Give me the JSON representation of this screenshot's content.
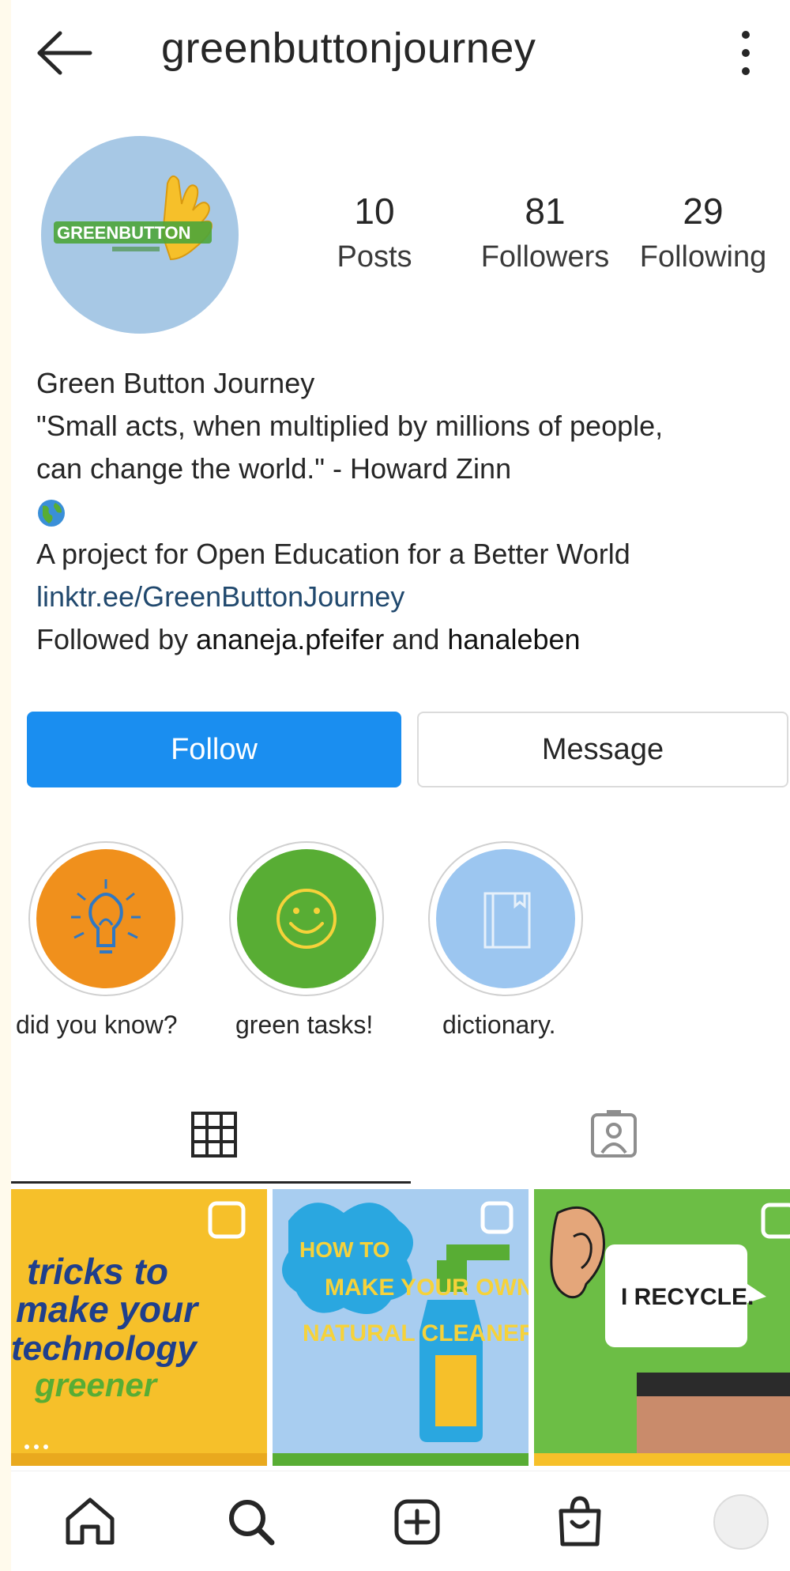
{
  "header": {
    "username": "greenbuttonjourney"
  },
  "profile": {
    "avatar_logo_text": "GREENBUTTON",
    "stats": [
      {
        "value": "10",
        "label": "Posts"
      },
      {
        "value": "81",
        "label": "Followers"
      },
      {
        "value": "29",
        "label": "Following"
      }
    ],
    "bio": {
      "name": "Green Button Journey",
      "quote_line1": "\"Small acts, when multiplied by millions of people,",
      "quote_line2": "can change the world.\" - Howard Zinn",
      "emoji_icon": "globe-icon",
      "description": "A project for Open Education for a Better World",
      "link": "linktr.ee/GreenButtonJourney",
      "followed_by_prefix": "Followed by ",
      "followed_by_user1": "ananeja.pfeifer",
      "followed_by_and": " and ",
      "followed_by_user2": "hanaleben"
    }
  },
  "actions": {
    "follow_label": "Follow",
    "message_label": "Message"
  },
  "highlights": [
    {
      "label": "did you know?",
      "color": "#f0901c",
      "icon": "lightbulb-icon"
    },
    {
      "label": "green tasks!",
      "color": "#58ad34",
      "icon": "smiley-icon"
    },
    {
      "label": "dictionary.",
      "color": "#9cc6f0",
      "icon": "book-icon"
    }
  ],
  "tabs": [
    {
      "name": "grid",
      "icon": "grid-icon",
      "active": true
    },
    {
      "name": "tagged",
      "icon": "tagged-person-icon",
      "active": false
    }
  ],
  "posts": [
    {
      "lines": [
        "tricks to",
        "make your",
        "technology",
        "greener"
      ],
      "bg": "#f6c02a"
    },
    {
      "lines": [
        "HOW TO",
        "MAKE YOUR OWN",
        "NATURAL CLEANERS"
      ],
      "bg": "#a8cdf0"
    },
    {
      "lines": [
        "I RECYCLE."
      ],
      "bg": "#6cbe45"
    }
  ],
  "colors": {
    "follow_blue": "#1a8ef0",
    "link_blue": "#21496e"
  },
  "bottom_nav": [
    {
      "icon": "home-icon"
    },
    {
      "icon": "search-icon"
    },
    {
      "icon": "add-post-icon"
    },
    {
      "icon": "shop-bag-icon"
    },
    {
      "icon": "profile-avatar-icon"
    }
  ]
}
